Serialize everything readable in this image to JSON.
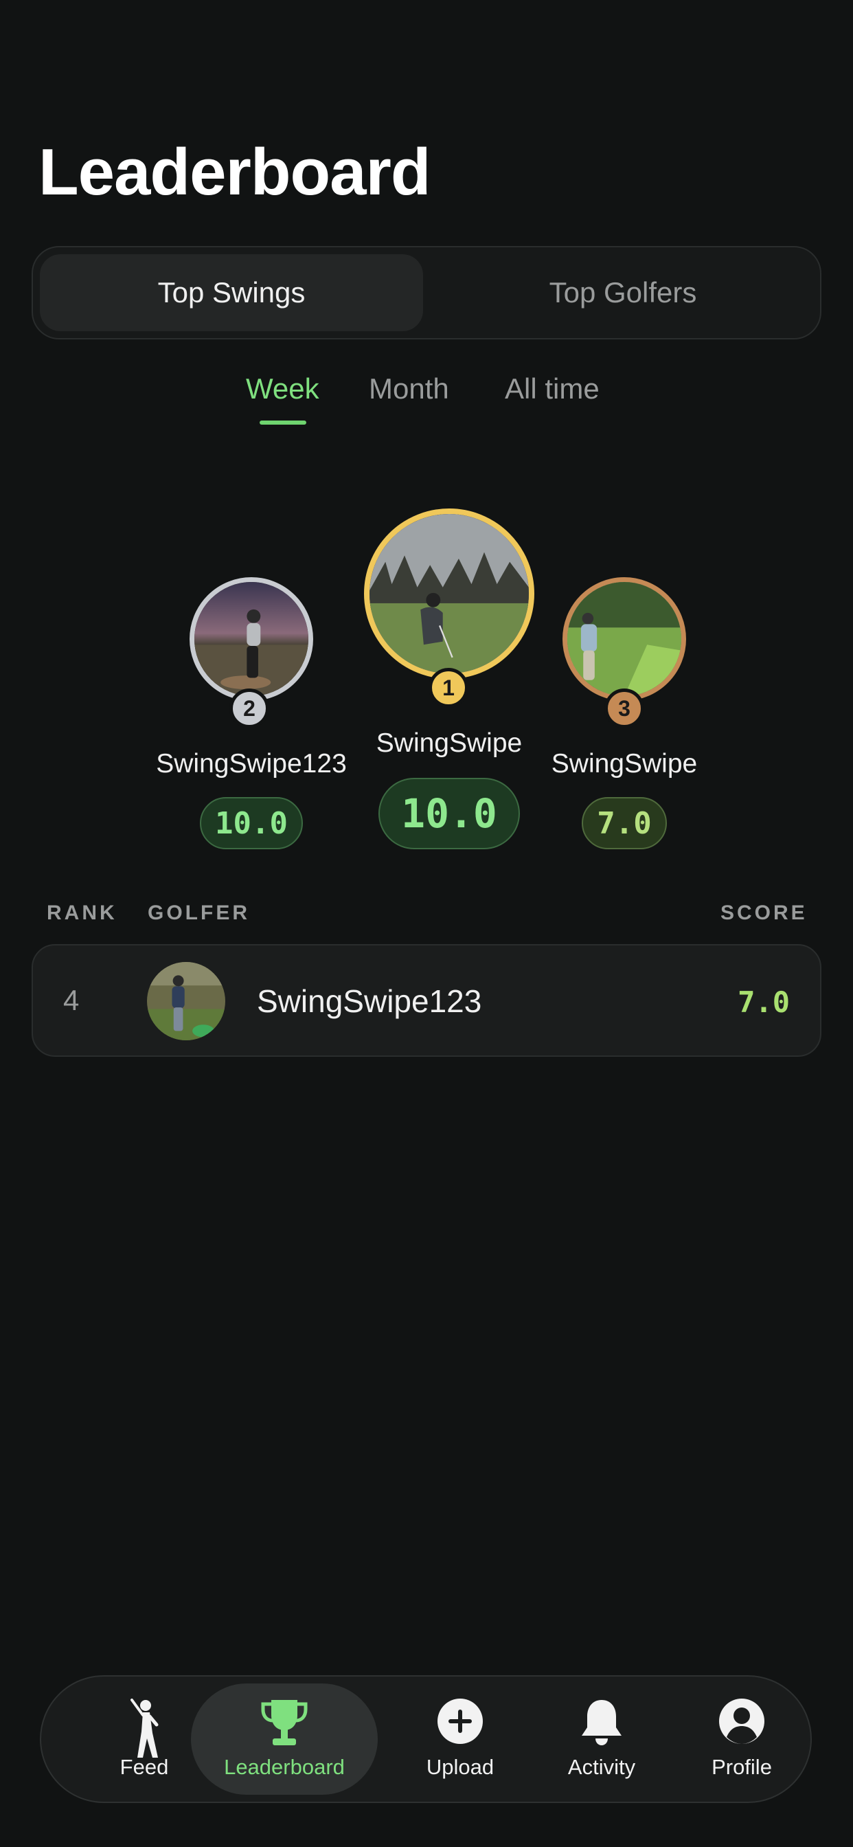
{
  "header": {
    "title": "Leaderboard"
  },
  "segment": {
    "active": "Top Swings",
    "inactive": "Top Golfers"
  },
  "period_tabs": {
    "week": "Week",
    "month": "Month",
    "all_time": "All time",
    "selected": "Week"
  },
  "podium": {
    "first": {
      "rank": "1",
      "name": "SwingSwipe",
      "score": "10.0",
      "ring_color": "#f0c85a"
    },
    "second": {
      "rank": "2",
      "name": "SwingSwipe123",
      "score": "10.0",
      "ring_color": "#c9ccd1"
    },
    "third": {
      "rank": "3",
      "name": "SwingSwipe",
      "score": "7.0",
      "ring_color": "#c58a55"
    }
  },
  "list": {
    "headers": {
      "rank": "RANK",
      "golfer": "GOLFER",
      "score": "SCORE"
    },
    "rows": [
      {
        "rank": "4",
        "name": "SwingSwipe123",
        "score": "7.0"
      }
    ]
  },
  "nav": {
    "items": [
      {
        "label": "Feed",
        "icon": "golfer-icon"
      },
      {
        "label": "Leaderboard",
        "icon": "trophy-icon",
        "active": true
      },
      {
        "label": "Upload",
        "icon": "plus-circle-icon"
      },
      {
        "label": "Activity",
        "icon": "bell-icon"
      },
      {
        "label": "Profile",
        "icon": "person-circle-icon"
      }
    ]
  },
  "colors": {
    "accent": "#7fe07f",
    "background": "#111313"
  }
}
